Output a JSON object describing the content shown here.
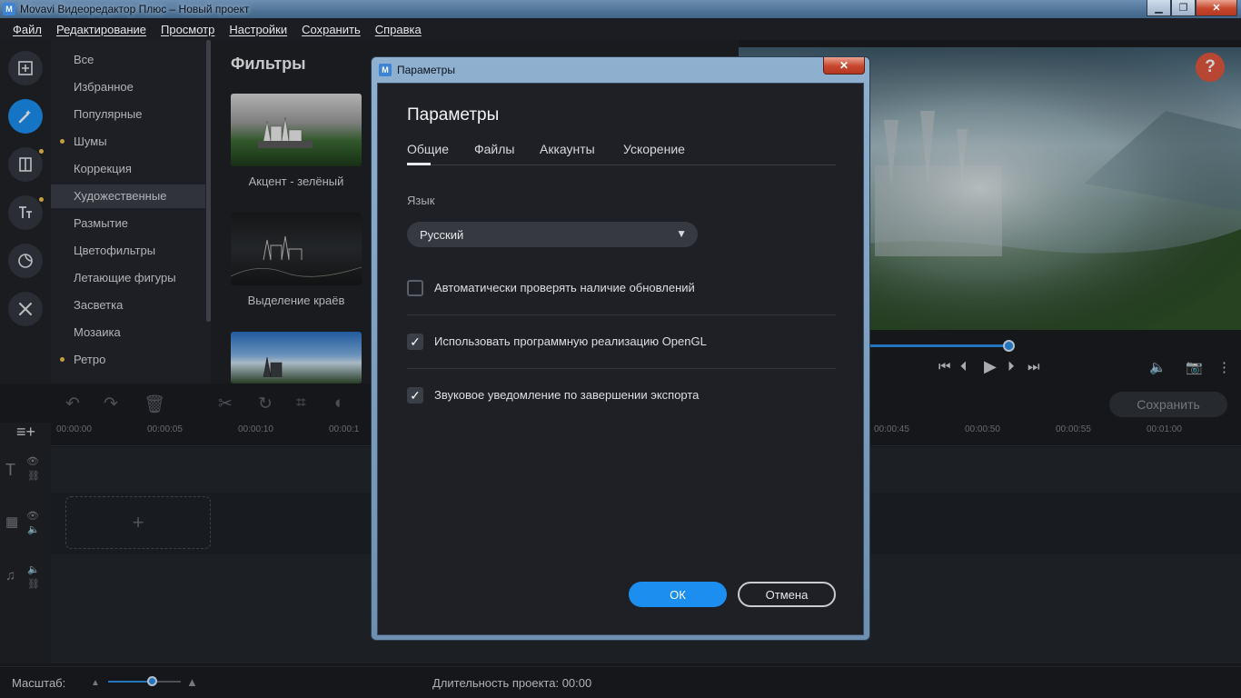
{
  "window": {
    "title": "Movavi Видеоредактор Плюс – Новый проект",
    "min": "▁",
    "max": "❐",
    "close": "✕"
  },
  "menu": [
    "Файл",
    "Редактирование",
    "Просмотр",
    "Настройки",
    "Сохранить",
    "Справка"
  ],
  "categories": {
    "items": [
      "Все",
      "Избранное",
      "Популярные",
      "Шумы",
      "Коррекция",
      "Художественные",
      "Размытие",
      "Цветофильтры",
      "Летающие фигуры",
      "Засветка",
      "Мозаика",
      "Ретро"
    ],
    "selected": "Художественные"
  },
  "filters": {
    "title": "Фильтры",
    "items": [
      "Акцент - зелёный",
      "Выделение краёв"
    ]
  },
  "help_label": "?",
  "timeline": {
    "save_label": "Сохранить",
    "ticks": [
      "00:00:00",
      "00:00:05",
      "00:00:10",
      "00:00:1",
      "00:00:45",
      "00:00:50",
      "00:00:55",
      "00:01:00"
    ],
    "drop_plus": "+"
  },
  "status": {
    "scale_label": "Масштаб:",
    "duration_label": "Длительность проекта: 00:00"
  },
  "dialog": {
    "window_title": "Параметры",
    "close": "✕",
    "heading": "Параметры",
    "tabs": [
      "Общие",
      "Файлы",
      "Аккаунты",
      "Ускорение"
    ],
    "active_tab": "Общие",
    "language_label": "Язык",
    "language_value": "Русский",
    "options": [
      {
        "label": "Автоматически проверять наличие обновлений",
        "checked": false
      },
      {
        "label": "Использовать программную реализацию OpenGL",
        "checked": true
      },
      {
        "label": "Звуковое уведомление по завершении экспорта",
        "checked": true
      }
    ],
    "ok": "ОК",
    "cancel": "Отмена"
  },
  "colors": {
    "accent": "#1b8ef0",
    "help": "#e0573e",
    "dot": "#f1c34a"
  }
}
